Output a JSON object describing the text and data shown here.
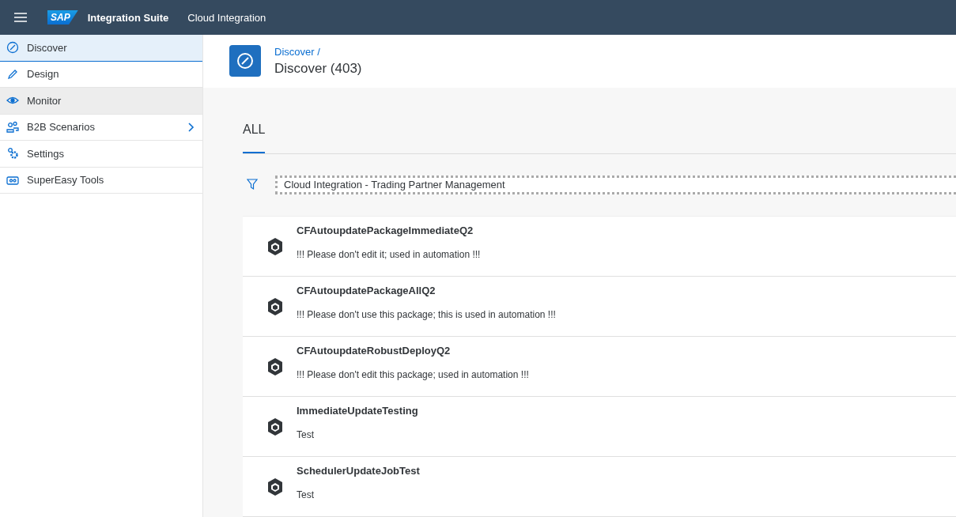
{
  "header": {
    "logo": "SAP",
    "product": "Integration Suite",
    "app": "Cloud Integration"
  },
  "sidebar": {
    "items": [
      {
        "kind": "compass",
        "label": "Discover",
        "selected": true,
        "hovered": false,
        "has_submenu": false
      },
      {
        "kind": "pencil",
        "label": "Design",
        "selected": false,
        "hovered": false,
        "has_submenu": false
      },
      {
        "kind": "eye",
        "label": "Monitor",
        "selected": false,
        "hovered": true,
        "has_submenu": false
      },
      {
        "kind": "people",
        "label": "B2B Scenarios",
        "selected": false,
        "hovered": false,
        "has_submenu": true
      },
      {
        "kind": "gears",
        "label": "Settings",
        "selected": false,
        "hovered": false,
        "has_submenu": false
      },
      {
        "kind": "se",
        "label": "SuperEasy Tools",
        "selected": false,
        "hovered": false,
        "has_submenu": false
      }
    ]
  },
  "page": {
    "breadcrumb": "Discover /",
    "title": "Discover (403)"
  },
  "tabs": [
    {
      "label": "ALL",
      "selected": true
    }
  ],
  "filter": {
    "value": "Cloud Integration - Trading Partner Management"
  },
  "packages": [
    {
      "name": "CFAutoupdatePackageImmediateQ2",
      "description": "!!! Please don't edit it; used in automation !!!"
    },
    {
      "name": "CFAutoupdatePackageAllQ2",
      "description": "!!! Please don't use this package; this is used in automation !!!"
    },
    {
      "name": "CFAutoupdateRobustDeployQ2",
      "description": "!!! Please don't edit this package; used in automation !!!"
    },
    {
      "name": "ImmediateUpdateTesting",
      "description": "Test"
    },
    {
      "name": "SchedulerUpdateJobTest",
      "description": "Test"
    }
  ]
}
